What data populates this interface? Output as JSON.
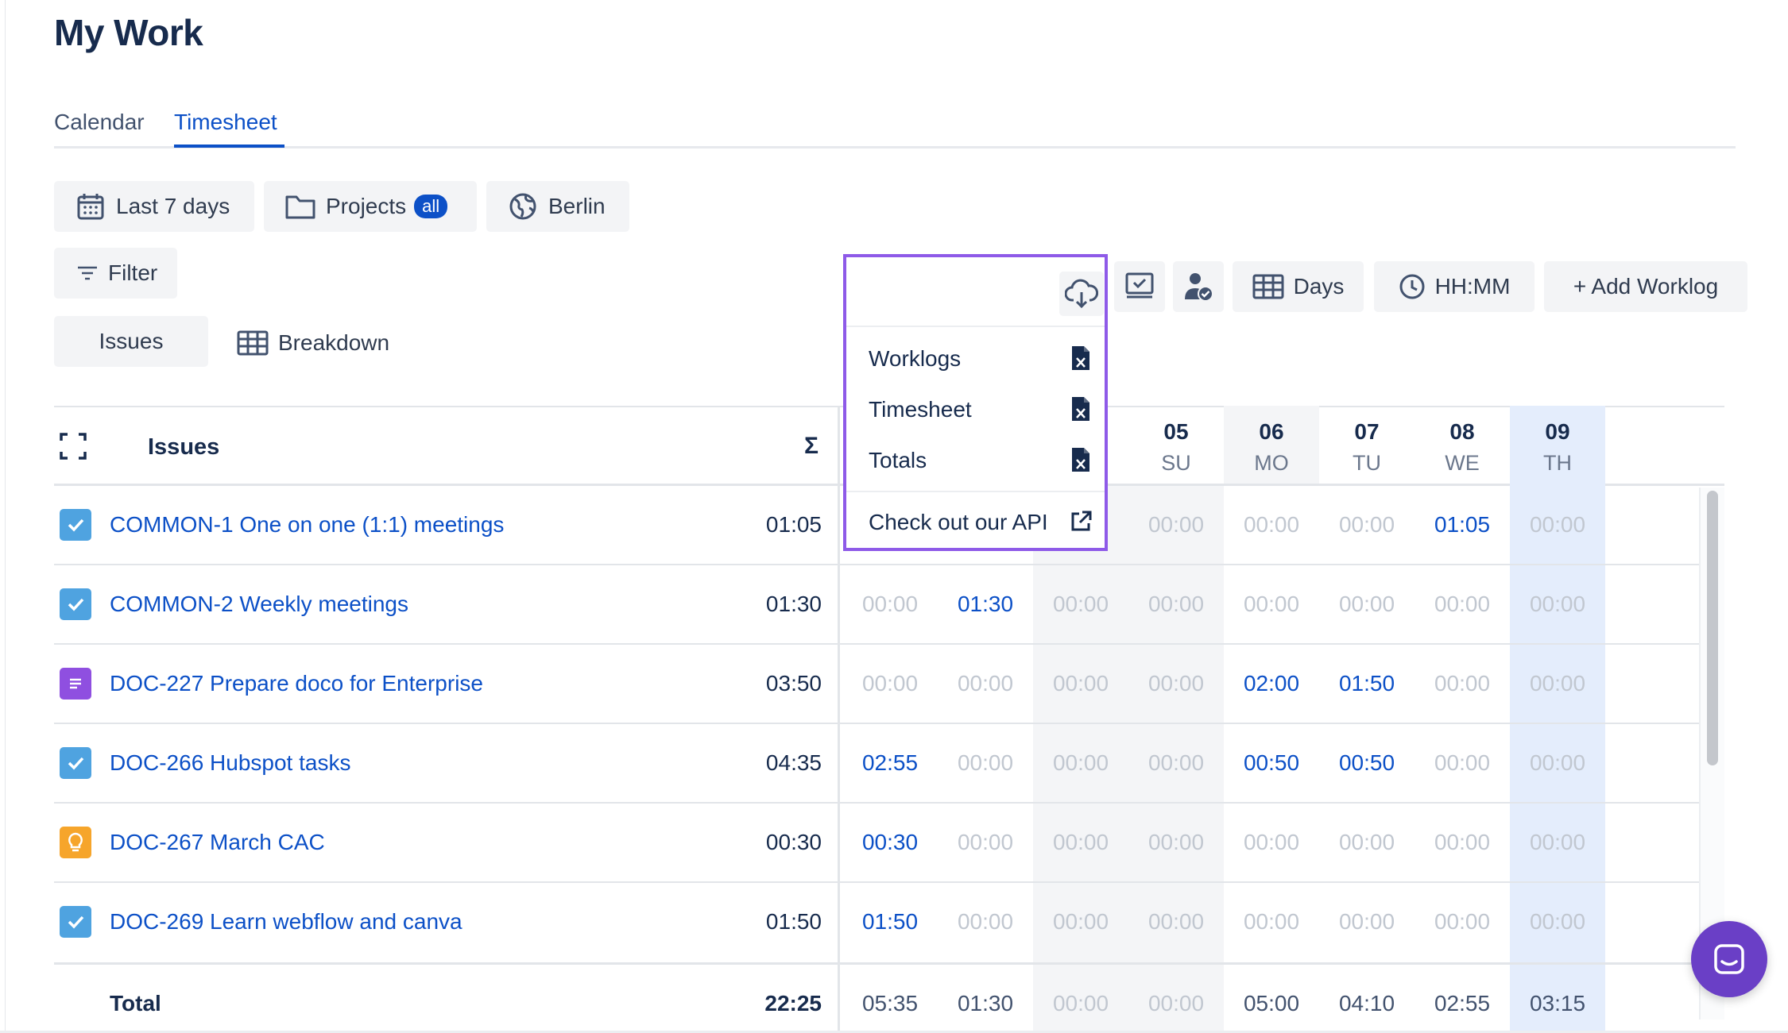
{
  "page": {
    "title": "My Work"
  },
  "tabs": [
    {
      "label": "Calendar",
      "active": false
    },
    {
      "label": "Timesheet",
      "active": true
    }
  ],
  "filters": {
    "date_range": "Last 7 days",
    "projects": "Projects",
    "projects_badge": "all",
    "timezone": "Berlin",
    "filter": "Filter"
  },
  "view_toggle": {
    "issues": "Issues",
    "breakdown": "Breakdown"
  },
  "toolbar": {
    "days": "Days",
    "time_format": "HH:MM",
    "add_worklog": "+ Add Worklog"
  },
  "export_menu": {
    "items": [
      "Worklogs",
      "Timesheet",
      "Totals"
    ],
    "api_link": "Check out our API"
  },
  "table": {
    "issues_header": "Issues",
    "sum_header": "Σ",
    "days": [
      {
        "num": "05",
        "name": "SU"
      },
      {
        "num": "06",
        "name": "MO"
      },
      {
        "num": "07",
        "name": "TU"
      },
      {
        "num": "08",
        "name": "WE"
      },
      {
        "num": "09",
        "name": "TH"
      }
    ],
    "rows": [
      {
        "issue": "COMMON-1 One on one (1:1) meetings",
        "total": "01:05",
        "icon": "checkbox-icon",
        "cells": [
          "",
          "",
          "",
          "00:00",
          "00:00",
          "00:00",
          "01:05",
          "00:00"
        ]
      },
      {
        "issue": "COMMON-2 Weekly meetings",
        "total": "01:30",
        "icon": "checkbox-icon",
        "cells": [
          "00:00",
          "01:30",
          "00:00",
          "00:00",
          "00:00",
          "00:00",
          "00:00",
          "00:00"
        ]
      },
      {
        "issue": "DOC-227 Prepare doco for Enterprise",
        "total": "03:50",
        "icon": "story-icon",
        "cells": [
          "00:00",
          "00:00",
          "00:00",
          "00:00",
          "02:00",
          "01:50",
          "00:00",
          "00:00"
        ]
      },
      {
        "issue": "DOC-266 Hubspot tasks",
        "total": "04:35",
        "icon": "checkbox-icon",
        "cells": [
          "02:55",
          "00:00",
          "00:00",
          "00:00",
          "00:50",
          "00:50",
          "00:00",
          "00:00"
        ]
      },
      {
        "issue": "DOC-267 March CAC",
        "total": "00:30",
        "icon": "idea-icon",
        "cells": [
          "00:30",
          "00:00",
          "00:00",
          "00:00",
          "00:00",
          "00:00",
          "00:00",
          "00:00"
        ]
      },
      {
        "issue": "DOC-269 Learn webflow and canva",
        "total": "01:50",
        "icon": "checkbox-icon",
        "cells": [
          "01:50",
          "00:00",
          "00:00",
          "00:00",
          "00:00",
          "00:00",
          "00:00",
          "00:00"
        ]
      }
    ],
    "totals": {
      "label": "Total",
      "sum": "22:25",
      "cells": [
        "05:35",
        "01:30",
        "00:00",
        "00:00",
        "05:00",
        "04:10",
        "02:55",
        "03:15"
      ]
    }
  },
  "colors": {
    "accent": "#0c50c7",
    "highlight": "#8e5ae8",
    "today_bg": "#e4edfc",
    "weekend_bg": "#f4f5f7"
  }
}
